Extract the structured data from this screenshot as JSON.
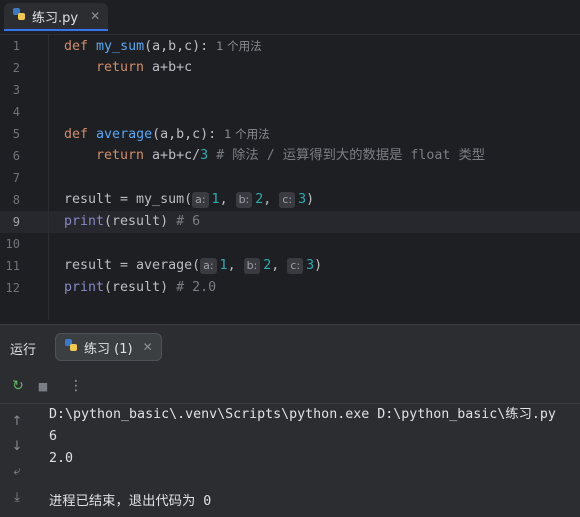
{
  "tab": {
    "filename": "练习.py",
    "close": "✕"
  },
  "editor": {
    "line_numbers": [
      "1",
      "2",
      "3",
      "4",
      "5",
      "6",
      "7",
      "8",
      "9",
      "10",
      "11",
      "12"
    ],
    "current_line": "9",
    "usage_hint": "1 个用法",
    "code": {
      "l1_kw": "def",
      "l1_fn": "my_sum",
      "l1_rest": "(a,b,c):",
      "l2_kw": "return",
      "l2_rest": " a+b+c",
      "l5_kw": "def",
      "l5_fn": "average",
      "l5_rest": "(a,b,c):",
      "l6_kw": "return",
      "l6_rest": " a+b+c/",
      "l6_num": "3",
      "l6_comment": " # 除法 / 运算得到大的数据是 float 类型",
      "l8_pre": "result = my_sum(",
      "l8_a": "1",
      "l8_b": "2",
      "l8_c": "3",
      "l8_post": ")",
      "l9_bi": "print",
      "l9_rest": "(result) ",
      "l9_comment": "# 6",
      "l11_pre": "result = average(",
      "l11_a": "1",
      "l11_b": "2",
      "l11_c": "3",
      "l11_post": ")",
      "l12_bi": "print",
      "l12_rest": "(result) ",
      "l12_comment": "# 2.0",
      "hint_a": "a:",
      "hint_b": "b:",
      "hint_c": "c:",
      "comma": ", "
    }
  },
  "run_panel": {
    "label": "运行",
    "tab_label": "练习 (1)",
    "tab_close": "✕",
    "toolbar": {
      "rerun_icon": "↻",
      "stop_icon": "■",
      "more_icon": "⋮"
    },
    "side": {
      "up_icon": "↑",
      "down_icon": "↓",
      "wrap_icon": "⤶",
      "scroll_end_icon": "⤓"
    },
    "output": [
      "D:\\python_basic\\.venv\\Scripts\\python.exe D:\\python_basic\\练习.py",
      "6",
      "2.0",
      "",
      "进程已结束，退出代码为 0"
    ]
  },
  "colors": {
    "accent": "#3574f0",
    "keyword": "#cf8e6d",
    "function": "#56a8f5",
    "number": "#2aacb8",
    "comment": "#7a7e85"
  }
}
